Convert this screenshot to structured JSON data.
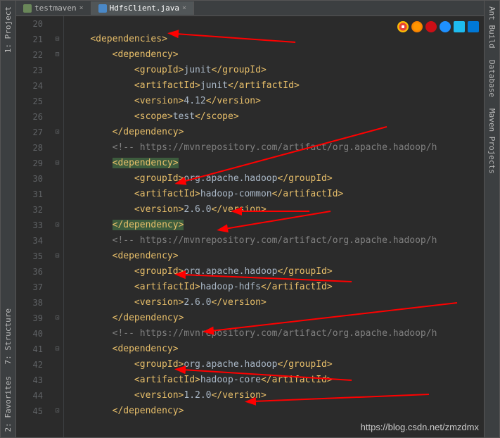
{
  "tabs": {
    "tab1": "testmaven",
    "tab2": "HdfsClient.java"
  },
  "sidebar": {
    "left1": "1: Project",
    "left2": "7: Structure",
    "left3": "2: Favorites",
    "right1": "Ant Build",
    "right2": "Database",
    "right3": "Maven Projects"
  },
  "gutter": {
    "start": 20,
    "end": 45
  },
  "code": {
    "l20": "",
    "l21_open": "dependencies",
    "l22_open": "dependency",
    "l23": {
      "tag": "groupId",
      "val": "junit"
    },
    "l24": {
      "tag": "artifactId",
      "val": "junit"
    },
    "l25": {
      "tag": "version",
      "val": "4.12"
    },
    "l26": {
      "tag": "scope",
      "val": "test"
    },
    "l27_close": "dependency",
    "l28_comment": "<!-- https://mvnrepository.com/artifact/org.apache.hadoop/h",
    "l29_open": "dependency",
    "l30": {
      "tag": "groupId",
      "val": "org.apache.hadoop"
    },
    "l31": {
      "tag": "artifactId",
      "val": "hadoop-common"
    },
    "l32": {
      "tag": "version",
      "val": "2.6.0"
    },
    "l33_close": "dependency",
    "l34_comment": "<!-- https://mvnrepository.com/artifact/org.apache.hadoop/h",
    "l35_open": "dependency",
    "l36": {
      "tag": "groupId",
      "val": "org.apache.hadoop"
    },
    "l37": {
      "tag": "artifactId",
      "val": "hadoop-hdfs"
    },
    "l38": {
      "tag": "version",
      "val": "2.6.0"
    },
    "l39_close": "dependency",
    "l40_comment": "<!-- https://mvnrepository.com/artifact/org.apache.hadoop/h",
    "l41_open": "dependency",
    "l42": {
      "tag": "groupId",
      "val": "org.apache.hadoop"
    },
    "l43": {
      "tag": "artifactId",
      "val": "hadoop-core"
    },
    "l44": {
      "tag": "version",
      "val": "1.2.0"
    },
    "l45_close": "dependency"
  },
  "watermark": "https://blog.csdn.net/zmzdmx"
}
